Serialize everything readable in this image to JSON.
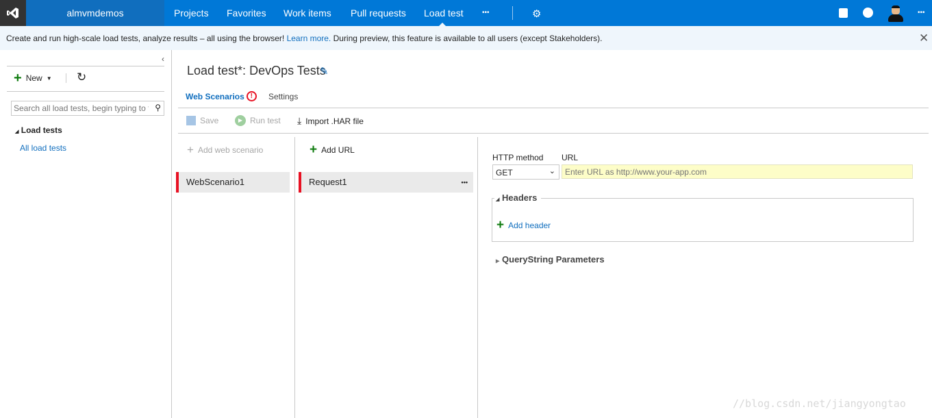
{
  "topbar": {
    "org": "almvmdemos",
    "nav": [
      "Projects",
      "Favorites",
      "Work items",
      "Pull requests",
      "Load test"
    ],
    "active": "Load test",
    "more": "•••"
  },
  "banner": {
    "text1": "Create and run high-scale load tests, analyze results – all using the browser! ",
    "link": "Learn more.",
    "text2": " During preview, this feature is available to all users (except Stakeholders)."
  },
  "sidebar": {
    "new_label": "New",
    "search_placeholder": "Search all load tests, begin typing to f",
    "tree_header": "Load tests",
    "tree_item": "All load tests"
  },
  "main": {
    "title": "Load test*: DevOps Tests",
    "tabs": [
      "Web Scenarios",
      "Settings"
    ],
    "toolbar": {
      "save": "Save",
      "run": "Run test",
      "import": "Import .HAR file"
    }
  },
  "scenarios": {
    "add": "Add web scenario",
    "items": [
      "WebScenario1"
    ]
  },
  "requests": {
    "add": "Add URL",
    "items": [
      "Request1"
    ],
    "more": "•••"
  },
  "request_detail": {
    "method_label": "HTTP method",
    "method_value": "GET",
    "url_label": "URL",
    "url_placeholder": "Enter URL as http://www.your-app.com",
    "headers_label": "Headers",
    "add_header": "Add header",
    "query_label": "QueryString Parameters"
  },
  "watermark": "//blog.csdn.net/jiangyongtao",
  "colors": {
    "accent": "#0078d7",
    "error": "#e81123",
    "add": "#107c10",
    "url_bg": "#fdfdc8"
  }
}
